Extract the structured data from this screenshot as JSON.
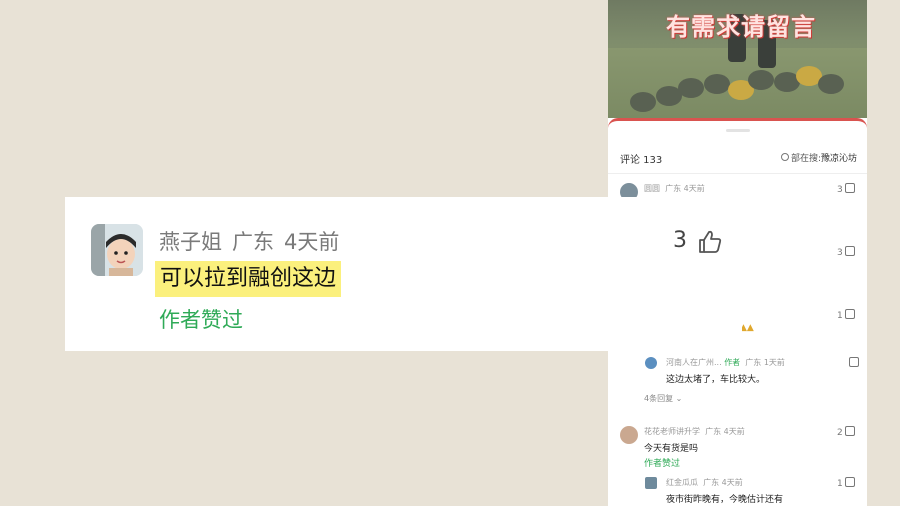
{
  "video": {
    "banner": "有需求请留言"
  },
  "comments_panel": {
    "header": "评论 133",
    "search_prefix": "部在搜:",
    "search_keyword": "豫凉沁坊",
    "comments": [
      {
        "user": "圆圆",
        "location": "广东",
        "time": "4天前",
        "likes": "3"
      },
      {
        "likes": "3"
      },
      {
        "likes": "1"
      },
      {
        "user": "河南人在广州...",
        "author_tag": "作者",
        "location": "广东",
        "time": "1天前",
        "text": "这边太堵了，车比较大。"
      },
      {
        "more": "4条回复"
      },
      {
        "user": "花花老师讲升学",
        "location": "广东",
        "time": "4天前",
        "text": "今天有货是吗",
        "author_liked": "作者赞过",
        "likes": "2"
      },
      {
        "user": "红金瓜瓜",
        "location": "广东",
        "time": "4天前",
        "text": "夜市街昨晚有，今晚估计还有",
        "likes": "1"
      }
    ]
  },
  "zoomed_comment": {
    "user": "燕子姐",
    "location": "广东",
    "time": "4天前",
    "text": "可以拉到融创这边",
    "author_liked": "作者赞过",
    "likes": "3",
    "highlight_color": "#fbf07d"
  }
}
